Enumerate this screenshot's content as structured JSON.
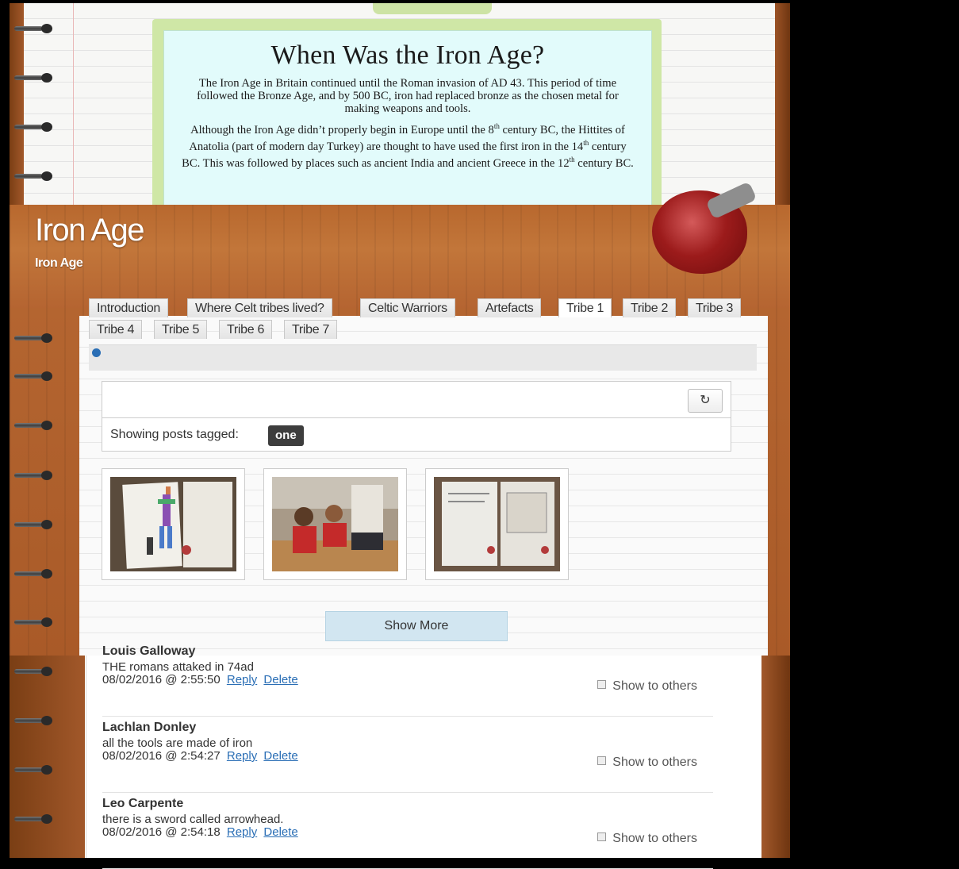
{
  "embedded_poster": {
    "title": "When Was the Iron Age?",
    "paragraph1": "The Iron Age in Britain continued until the Roman invasion of AD 43. This period of time followed the Bronze Age, and by 500 BC, iron had replaced bronze as the chosen metal for making weapons and tools.",
    "paragraph2_part1": "Although the Iron Age didn’t properly begin in Europe until the 8",
    "paragraph2_sup1": "th",
    "paragraph2_part2": " century BC, the Hittites of Anatolia (part of modern day Turkey) are thought to have used the first iron in the 14",
    "paragraph2_sup2": "th",
    "paragraph2_part3": " century BC. This was followed by places such as ancient India and ancient Greece in the 12",
    "paragraph2_sup3": "th",
    "paragraph2_part4": " century BC."
  },
  "header": {
    "title": "Iron Age",
    "tagline": "Iron Age"
  },
  "tabs": [
    {
      "label": "Introduction"
    },
    {
      "label": "Where Celt tribes lived?"
    },
    {
      "label": "Celtic Warriors"
    },
    {
      "label": "Artefacts"
    },
    {
      "label": "Tribe 1",
      "active": true
    },
    {
      "label": "Tribe 2"
    },
    {
      "label": "Tribe 3"
    },
    {
      "label": "Tribe 4"
    },
    {
      "label": "Tribe 5"
    },
    {
      "label": "Tribe 6"
    },
    {
      "label": "Tribe 7"
    }
  ],
  "feed": {
    "refresh_icon": "refresh-icon",
    "refresh_glyph": "↻",
    "showing_label": "Showing posts tagged:",
    "tag": "one",
    "show_more_label": "Show More"
  },
  "comments": [
    {
      "author": "Louis Galloway",
      "text": "THE romans attaked in 74ad",
      "timestamp": "08/02/2016 @ 2:55:50",
      "reply_label": "Reply",
      "delete_label": "Delete",
      "share_label": "Show to others",
      "share_checked": true
    },
    {
      "author": "Lachlan Donley",
      "text": "all the tools are made of iron",
      "timestamp": "08/02/2016 @ 2:54:27",
      "reply_label": "Reply",
      "delete_label": "Delete",
      "share_label": "Show to others",
      "share_checked": true
    },
    {
      "author": "Leo Carpente",
      "text": "there is a sword called arrowhead.",
      "timestamp": "08/02/2016 @ 2:54:18",
      "reply_label": "Reply",
      "delete_label": "Delete",
      "share_label": "Show to others",
      "share_checked": true
    }
  ],
  "colors": {
    "wood": "#b8682e",
    "poster_bg": "#e2fbfb",
    "poster_frame": "#cfe7a6",
    "tag_badge": "#3d3d3d",
    "link": "#2a6eb5",
    "show_more_bg": "#d2e6f1"
  }
}
